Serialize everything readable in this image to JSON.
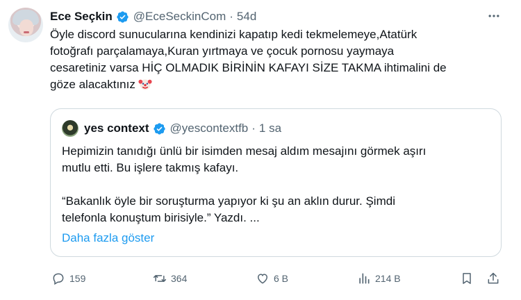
{
  "tweet": {
    "author_name": "Ece Seçkin",
    "handle": "@EceSeckinCom",
    "separator": "·",
    "time": "54d",
    "text": "Öyle discord sunucularına kendinizi kapatıp kedi tekmelemeye,Atatürk\nfotoğrafı parçalamaya,Kuran yırtmaya ve çocuk pornosu yaymaya\ncesaretiniz varsa HİÇ OLMADIK BİRİNİN KAFAYI SİZE TAKMA ihtimalini de\ngöze alacaktınız",
    "emoji": "clown-face-emoji"
  },
  "quote": {
    "author_name": "yes context",
    "handle": "@yescontextfb",
    "separator": "·",
    "time": "1 sa",
    "text": "Hepimizin tanıdığı ünlü bir isimden mesaj aldım mesajını görmek aşırı\nmutlu etti. Bu işlere takmış kafayı.\n\n“Bakanlık öyle bir soruşturma yapıyor ki şu an aklın durur. Şimdi\ntelefonla konuştum birisiyle.” Yazdı. ...",
    "show_more": "Daha fazla göster"
  },
  "actions": {
    "replies": "159",
    "reposts": "364",
    "likes": "6 B",
    "views": "214 B"
  },
  "icons": {
    "more": "more-horizontal-icon",
    "reply": "reply-icon",
    "repost": "repost-icon",
    "like": "heart-icon",
    "views": "analytics-icon",
    "bookmark": "bookmark-icon",
    "share": "share-icon",
    "verified": "verified-badge-icon"
  },
  "colors": {
    "accent": "#1d9bf0",
    "text": "#0f1419",
    "muted": "#536471",
    "border": "#cfd9de"
  }
}
